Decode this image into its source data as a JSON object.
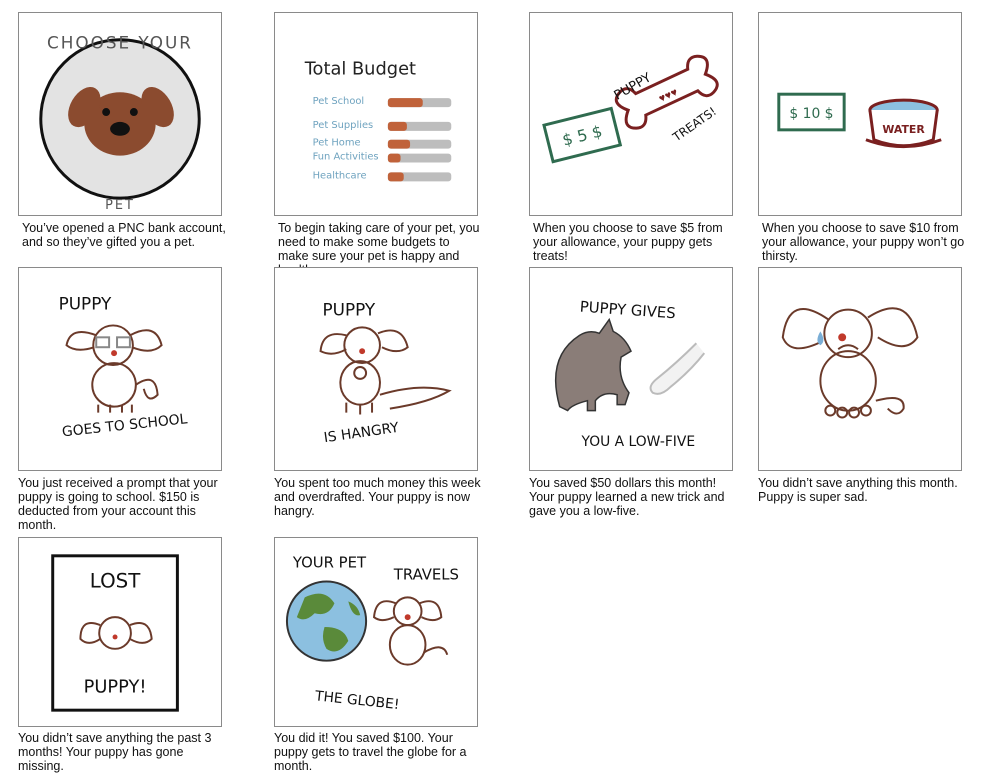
{
  "panels": [
    {
      "art": {
        "title_top": "CHOOSE YOUR",
        "title_bottom": "PET"
      },
      "caption": "You’ve opened a PNC bank account, and so they’ve gifted you a pet."
    },
    {
      "art": {
        "title": "Total Budget",
        "items": [
          "Pet School",
          "Pet Supplies",
          "Pet Home",
          "Fun Activities",
          "Healthcare"
        ],
        "levels": [
          0.55,
          0.3,
          0.35,
          0.2,
          0.25
        ]
      },
      "caption": "To begin taking care of your pet, you need to make some budgets to make sure your pet is happy and healthy."
    },
    {
      "art": {
        "money": "$ 5 $",
        "bone_line1": "PUPPY",
        "bone_line2": "TREATS!"
      },
      "caption": "When you choose to save $5 from your allowance, your puppy gets treats!"
    },
    {
      "art": {
        "money": "$ 10 $",
        "bowl": "WATER"
      },
      "caption": "When you choose to save $10 from your allowance, your puppy won’t go thirsty."
    },
    {
      "art": {
        "top": "PUPPY",
        "bottom": "GOES TO SCHOOL"
      },
      "caption": "You just received a prompt that your puppy is going to school. $150 is deducted from your account this month."
    },
    {
      "art": {
        "top": "PUPPY",
        "bottom": "IS HANGRY"
      },
      "caption": "You spent too much money this week and overdrafted. Your puppy is now hangry."
    },
    {
      "art": {
        "top": "PUPPY GIVES",
        "bottom": "YOU A LOW-FIVE"
      },
      "caption": "You saved $50 dollars this month! Your puppy learned a new trick and gave you a low-five."
    },
    {
      "art": {},
      "caption": "You didn’t save anything this month. Puppy is super sad."
    },
    {
      "art": {
        "top": "LOST",
        "bottom": "PUPPY!"
      },
      "caption": "You didn’t save anything the past 3 months! Your puppy has gone missing."
    },
    {
      "art": {
        "top_left": "YOUR PET",
        "top_right": "TRAVELS",
        "bottom": "THE GLOBE!"
      },
      "caption": "You did it! You saved $100. Your puppy gets to travel the globe for a month."
    }
  ],
  "colors": {
    "brown": "#8a4a2e",
    "orange": "#c0623a",
    "gray": "#bdbdbd",
    "green": "#2f6b4f",
    "maroon": "#7a2020",
    "blue": "#7aaed6",
    "ink": "#3b2a22"
  }
}
